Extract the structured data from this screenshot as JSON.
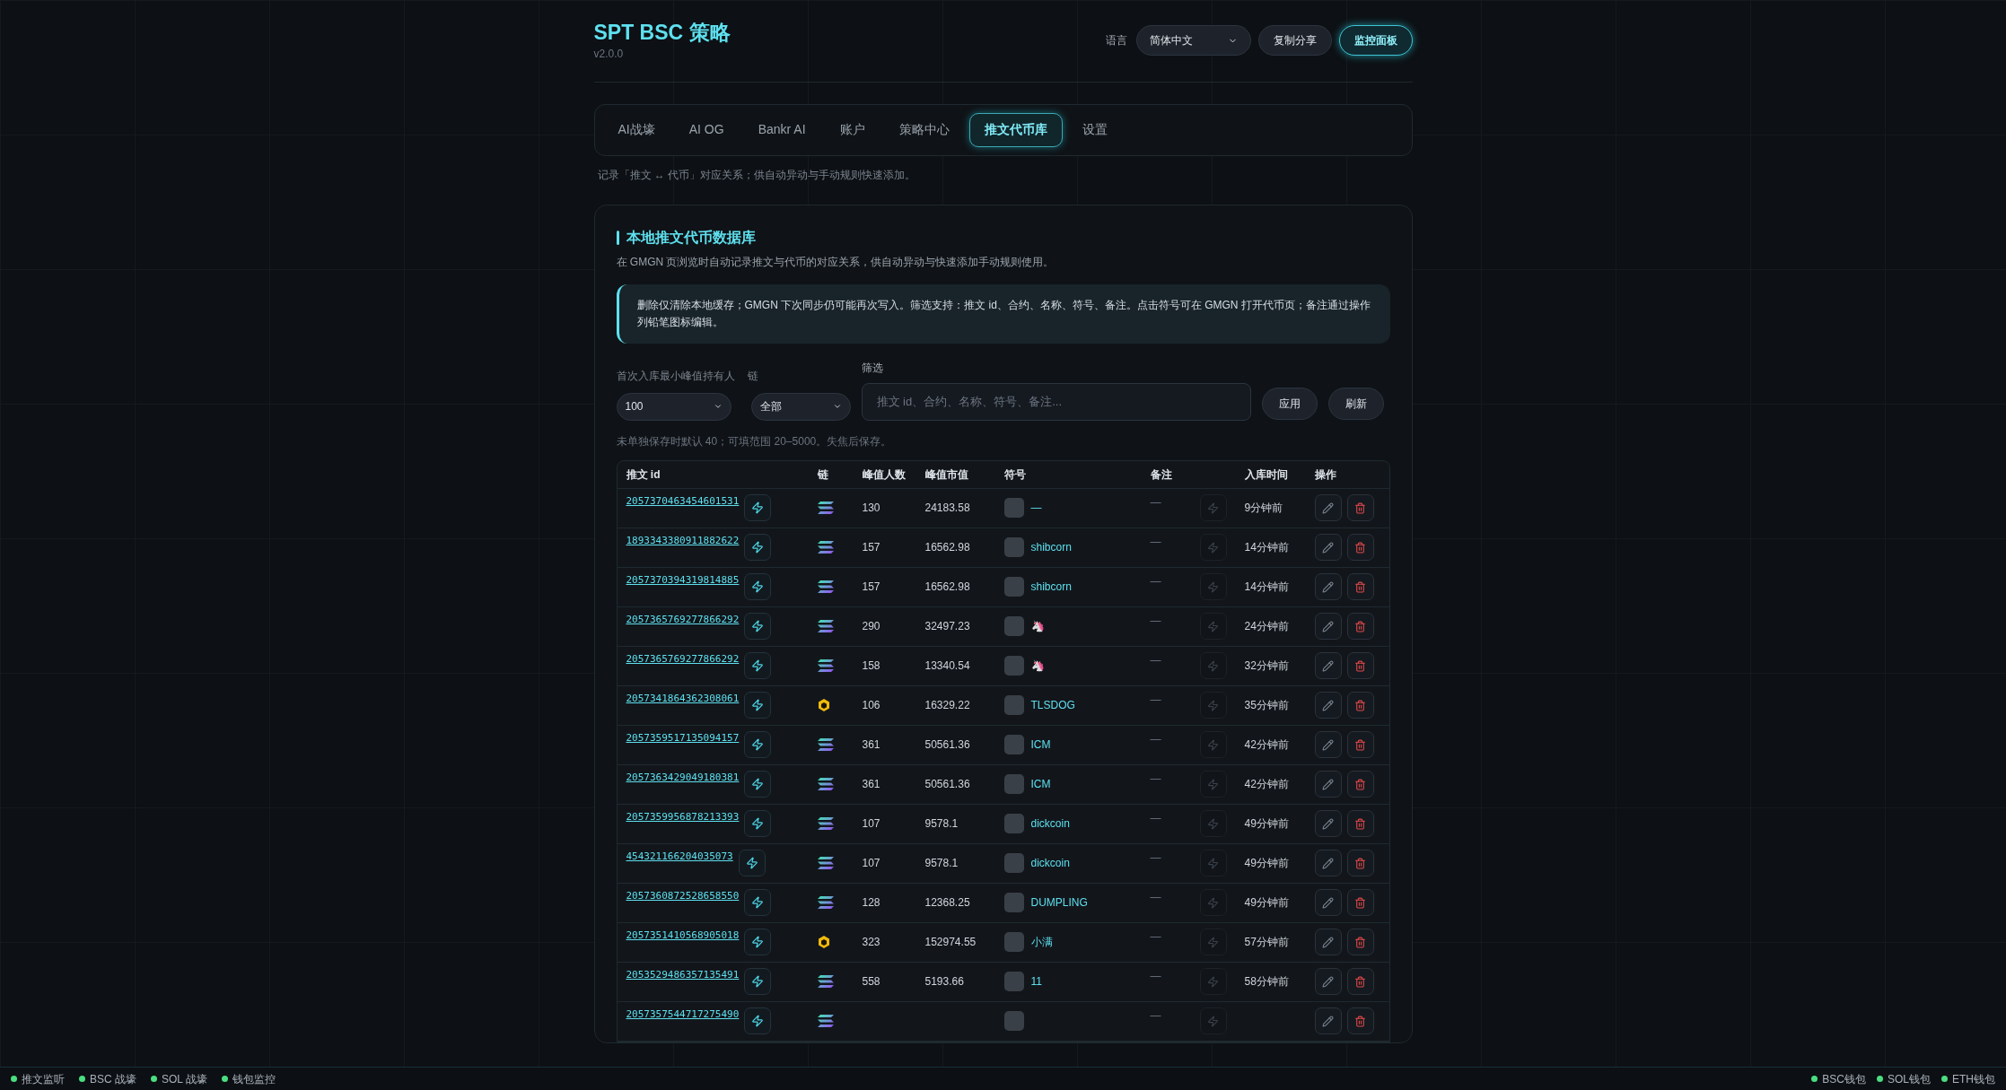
{
  "app": {
    "title": "SPT BSC 策略",
    "version": "v2.0.0"
  },
  "header": {
    "language_label": "语言",
    "language_value": "简体中文",
    "share_button": "复制分享",
    "monitor_button": "监控面板"
  },
  "tabs": [
    {
      "label": "AI战壕",
      "selected": false
    },
    {
      "label": "AI OG",
      "selected": false
    },
    {
      "label": "Bankr AI",
      "selected": false
    },
    {
      "label": "账户",
      "selected": false
    },
    {
      "label": "策略中心",
      "selected": false
    },
    {
      "label": "推文代币库",
      "selected": true
    },
    {
      "label": "设置",
      "selected": false
    }
  ],
  "tab_hint": "记录「推文 ↔ 代币」对应关系；供自动异动与手动规则快速添加。",
  "card": {
    "title": "本地推文代币数据库",
    "description": "在 GMGN 页浏览时自动记录推文与代币的对应关系，供自动异动与快速添加手动规则使用。",
    "info": "删除仅清除本地缓存；GMGN 下次同步仍可能再次写入。筛选支持：推文 id、合约、名称、符号、备注。点击符号可在 GMGN 打开代币页；备注通过操作列铅笔图标编辑。"
  },
  "filters": {
    "min_holders_label": "首次入库最小峰值持有人",
    "min_holders_value": "100",
    "chain_label": "链",
    "chain_value": "全部",
    "search_label": "筛选",
    "search_placeholder": "推文 id、合约、名称、符号、备注...",
    "apply_button": "应用",
    "refresh_button": "刷新",
    "note": "未单独保存时默认 40；可填范围 20–5000。失焦后保存。"
  },
  "table": {
    "columns": [
      "推文 id",
      "链",
      "峰值人数",
      "峰值市值",
      "符号",
      "备注",
      "入库时间",
      "操作"
    ],
    "rows": [
      {
        "tweet_id": "2057370463454601531",
        "kind": "sol",
        "peak_holders": "130",
        "peak_mcap": "24183.58",
        "symbol": "—",
        "note": "—",
        "added": "9分钟前"
      },
      {
        "tweet_id": "1893343380911882622",
        "kind": "sol",
        "peak_holders": "157",
        "peak_mcap": "16562.98",
        "symbol": "shibcorn",
        "note": "—",
        "added": "14分钟前"
      },
      {
        "tweet_id": "2057370394319814885",
        "kind": "sol",
        "peak_holders": "157",
        "peak_mcap": "16562.98",
        "symbol": "shibcorn",
        "note": "—",
        "added": "14分钟前"
      },
      {
        "tweet_id": "2057365769277866292",
        "kind": "sol",
        "peak_holders": "290",
        "peak_mcap": "32497.23",
        "symbol": "🦄",
        "note": "—",
        "added": "24分钟前"
      },
      {
        "tweet_id": "2057365769277866292",
        "kind": "sol",
        "peak_holders": "158",
        "peak_mcap": "13340.54",
        "symbol": "🦄",
        "note": "—",
        "added": "32分钟前"
      },
      {
        "tweet_id": "2057341864362308061",
        "kind": "bsc",
        "peak_holders": "106",
        "peak_mcap": "16329.22",
        "symbol": "TLSDOG",
        "note": "—",
        "added": "35分钟前"
      },
      {
        "tweet_id": "2057359517135094157",
        "kind": "sol",
        "peak_holders": "361",
        "peak_mcap": "50561.36",
        "symbol": "ICM",
        "note": "—",
        "added": "42分钟前"
      },
      {
        "tweet_id": "2057363429049180381",
        "kind": "sol",
        "peak_holders": "361",
        "peak_mcap": "50561.36",
        "symbol": "ICM",
        "note": "—",
        "added": "42分钟前"
      },
      {
        "tweet_id": "2057359956878213393",
        "kind": "sol",
        "peak_holders": "107",
        "peak_mcap": "9578.1",
        "symbol": "dickcoin",
        "note": "—",
        "added": "49分钟前"
      },
      {
        "tweet_id": "454321166204035073",
        "kind": "sol",
        "peak_holders": "107",
        "peak_mcap": "9578.1",
        "symbol": "dickcoin",
        "note": "—",
        "added": "49分钟前"
      },
      {
        "tweet_id": "2057360872528658550",
        "kind": "sol",
        "peak_holders": "128",
        "peak_mcap": "12368.25",
        "symbol": "DUMPLING",
        "note": "—",
        "added": "49分钟前"
      },
      {
        "tweet_id": "2057351410568905018",
        "kind": "bsc",
        "peak_holders": "323",
        "peak_mcap": "152974.55",
        "symbol": "小满",
        "note": "—",
        "added": "57分钟前"
      },
      {
        "tweet_id": "2053529486357135491",
        "kind": "sol",
        "peak_holders": "558",
        "peak_mcap": "5193.66",
        "symbol": "11",
        "note": "—",
        "added": "58分钟前"
      },
      {
        "tweet_id": "2057357544717275490",
        "kind": "sol",
        "note": "—"
      }
    ]
  },
  "status_left": [
    "推文监听",
    "BSC 战壕",
    "SOL 战壕",
    "钱包监控"
  ],
  "status_right": [
    "BSC钱包",
    "SOL钱包",
    "ETH钱包"
  ]
}
